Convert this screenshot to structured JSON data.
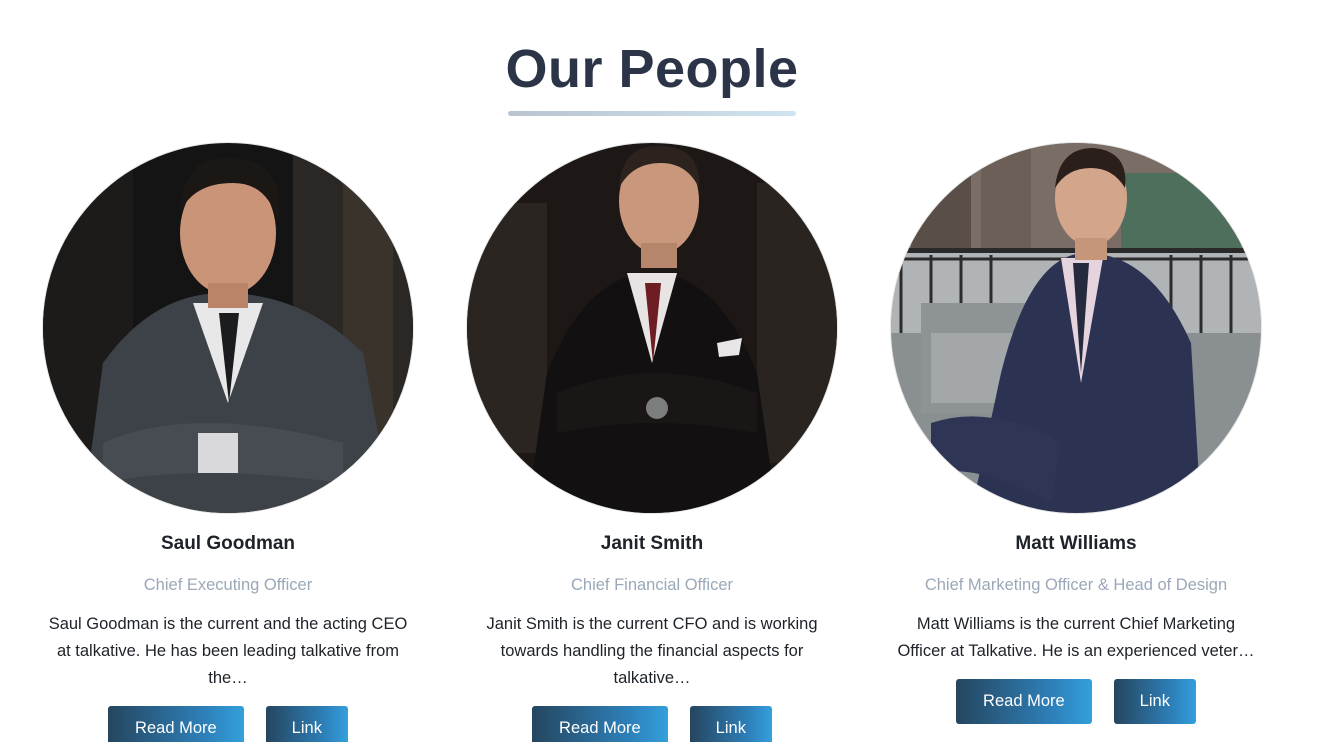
{
  "section": {
    "title": "Our People"
  },
  "people": [
    {
      "name": "Saul Goodman",
      "role": "Chief Executing Officer",
      "bio": "Saul Goodman is the current and the acting CEO at talkative. He has been leading talkative from the…",
      "read_more_label": "Read More",
      "link_label": "Link"
    },
    {
      "name": "Janit Smith",
      "role": "Chief Financial Officer",
      "bio": "Janit Smith is the current CFO and is working towards handling the financial aspects for talkative…",
      "read_more_label": "Read More",
      "link_label": "Link"
    },
    {
      "name": "Matt Williams",
      "role": "Chief Marketing Officer & Head of Design",
      "bio": "Matt Williams is the current Chief Marketing Officer  at Talkative. He is an experienced veter…",
      "read_more_label": "Read More",
      "link_label": "Link"
    }
  ],
  "colors": {
    "title": "#2b3547",
    "role": "#9aa8b8",
    "button_start": "#25465f",
    "button_end": "#33a0dc"
  }
}
